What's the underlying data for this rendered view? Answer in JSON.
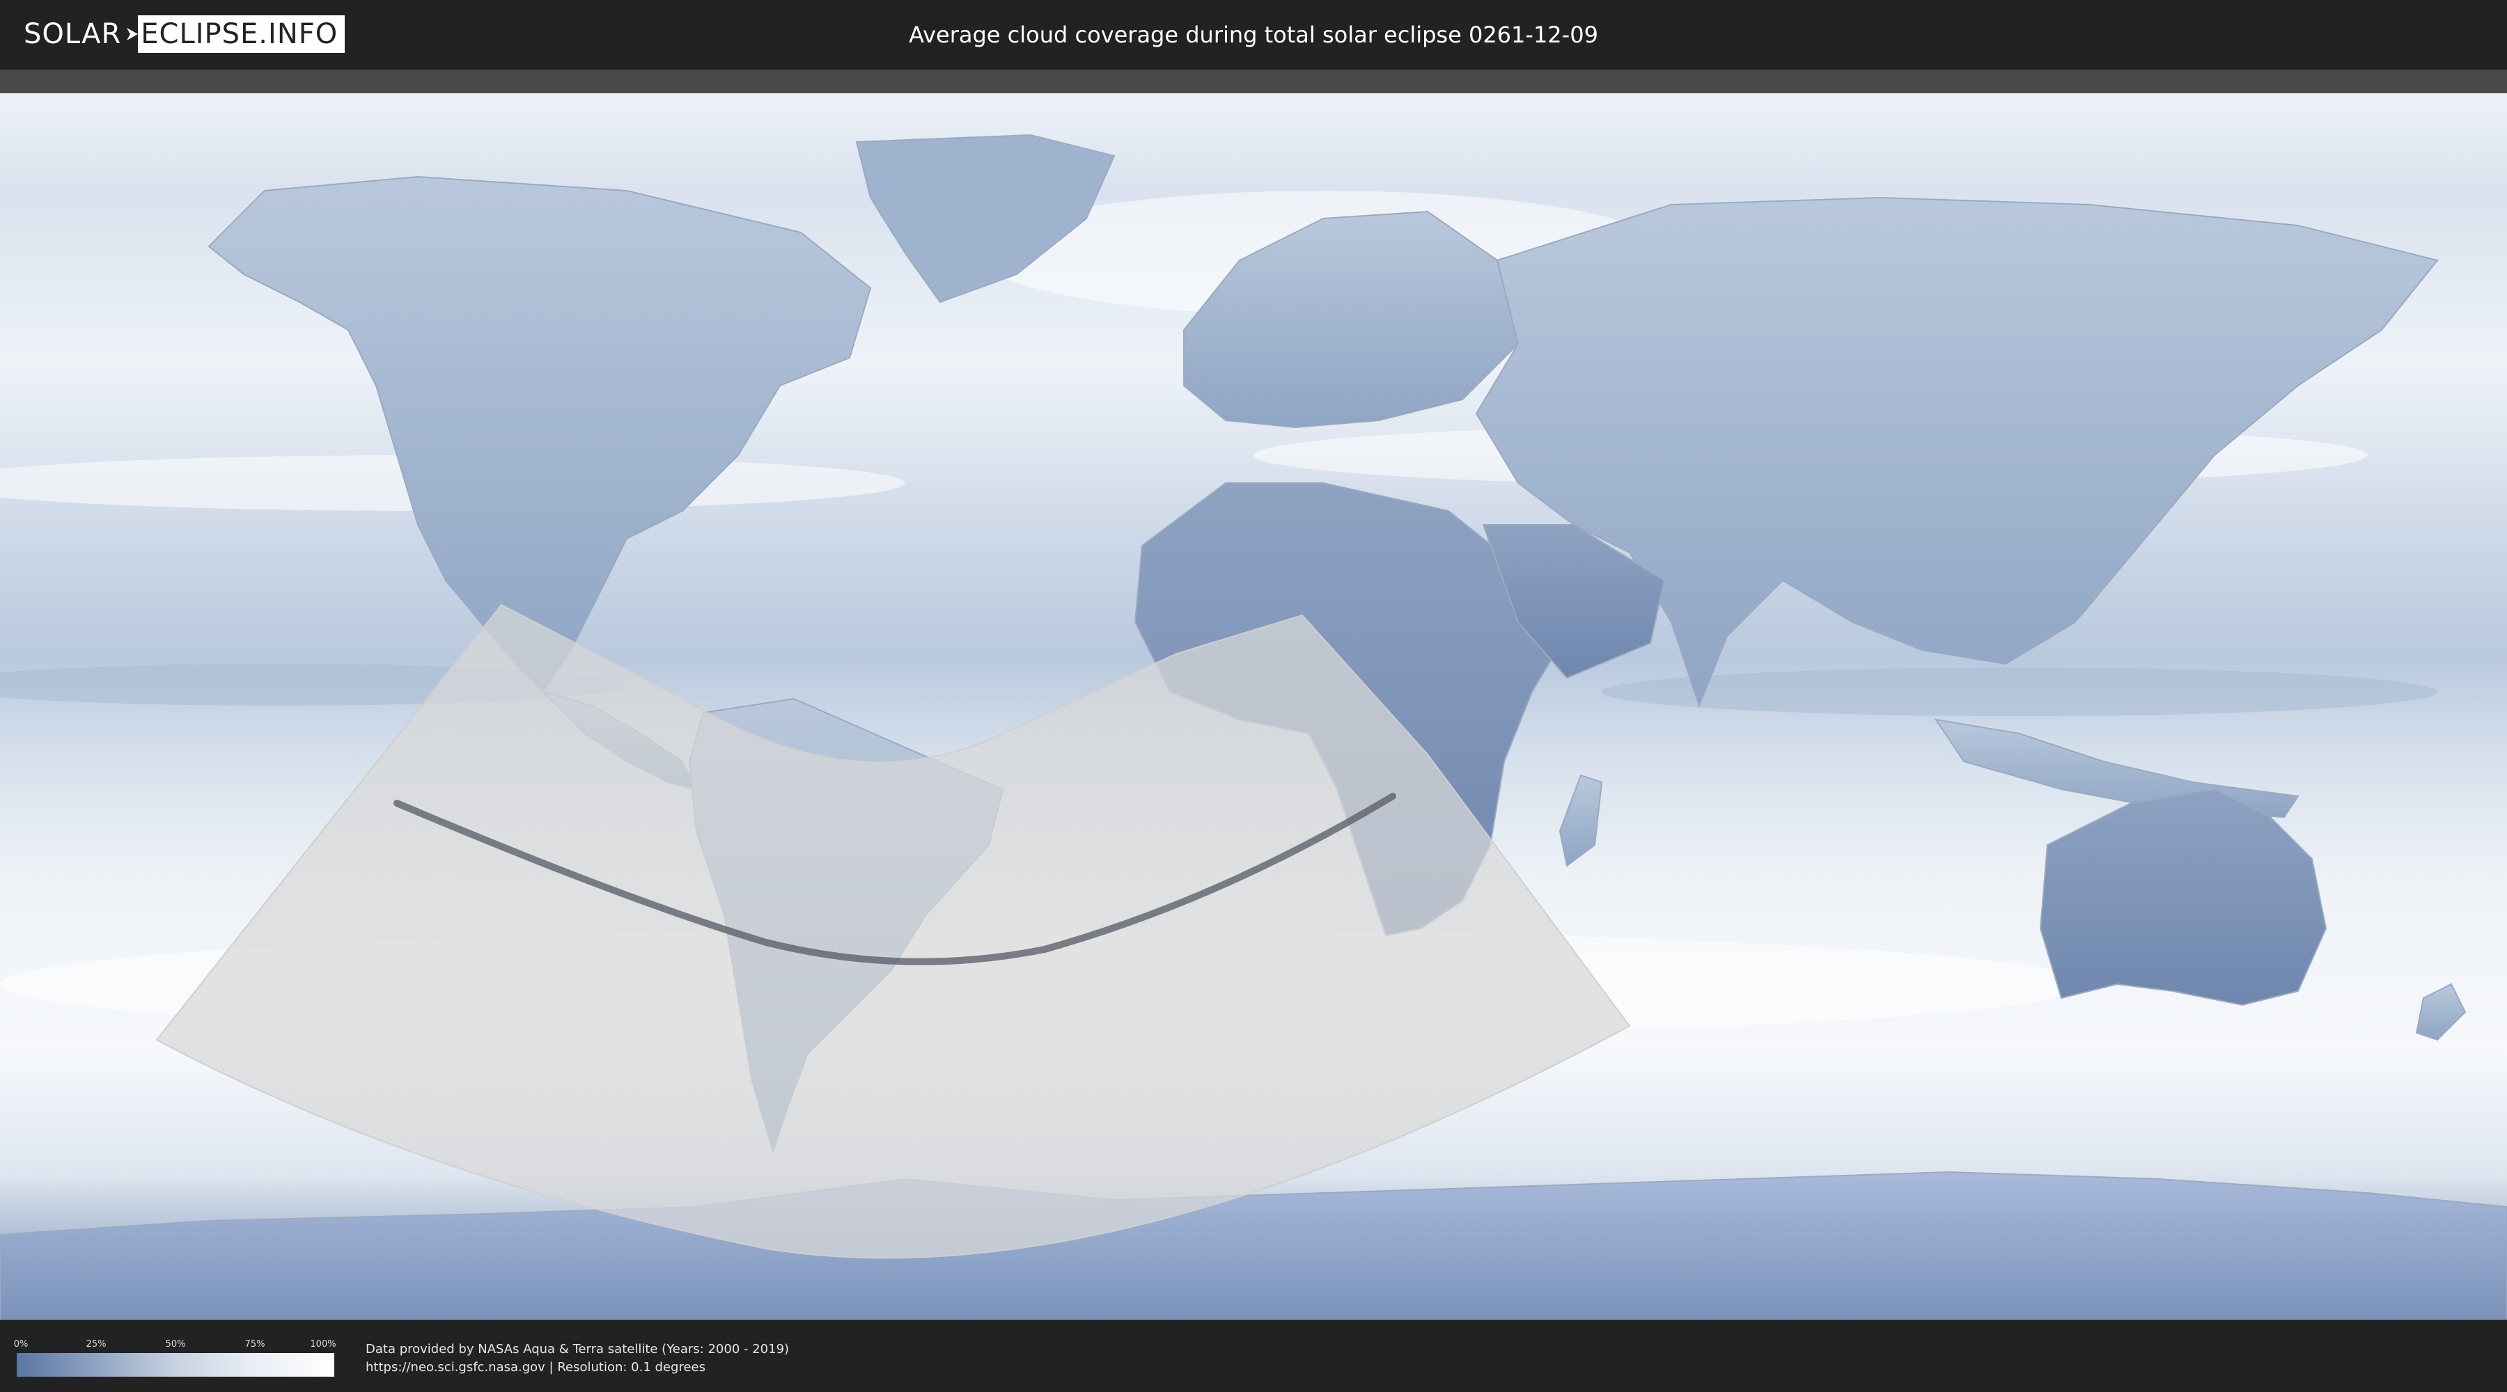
{
  "header": {
    "logo_part1": "SOLAR",
    "logo_part2": "ECLIPSE.INFO",
    "title": "Average cloud coverage during total solar eclipse 0261-12-09"
  },
  "legend": {
    "ticks": [
      "0%",
      "25%",
      "50%",
      "75%",
      "100%"
    ]
  },
  "credits": {
    "line1": "Data provided by NASAs Aqua & Terra satellite (Years: 2000 - 2019)",
    "line2": "https://neo.sci.gsfc.nasa.gov | Resolution: 0.1 degrees"
  },
  "colors": {
    "background": "#222222",
    "cloud_low": "#5a77a3",
    "cloud_high": "#ffffff",
    "eclipse_shadow": "#dcdcdc",
    "central_line": "#555a64"
  },
  "icons": {
    "logo_separator": "eclipse-arrow-icon"
  }
}
